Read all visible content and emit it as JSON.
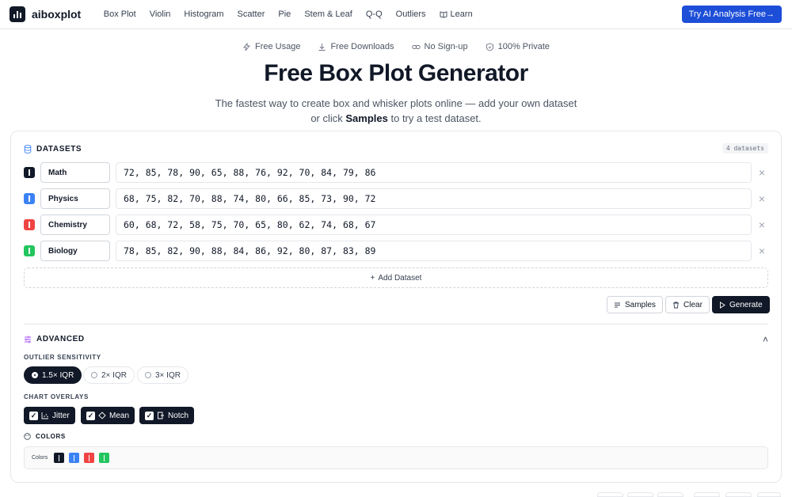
{
  "nav": {
    "logo_text": "aiboxplot",
    "links": [
      "Box Plot",
      "Violin",
      "Histogram",
      "Scatter",
      "Pie",
      "Stem & Leaf",
      "Q-Q",
      "Outliers",
      "Learn"
    ],
    "cta": "Try AI Analysis Free→"
  },
  "badges": [
    "Free Usage",
    "Free Downloads",
    "No Sign-up",
    "100% Private"
  ],
  "hero": {
    "title": "Free Box Plot Generator",
    "subtitle_pre": "The fastest way to create box and whisker plots online — add your own dataset or click ",
    "subtitle_bold": "Samples",
    "subtitle_post": " to try a test dataset."
  },
  "datasets": {
    "heading": "DATASETS",
    "count": "4 datasets",
    "rows": [
      {
        "name": "Math",
        "values": "72, 85, 78, 90, 65, 88, 76, 92, 70, 84, 79, 86",
        "color": "#111827"
      },
      {
        "name": "Physics",
        "values": "68, 75, 82, 70, 88, 74, 80, 66, 85, 73, 90, 72",
        "color": "#3b82f6"
      },
      {
        "name": "Chemistry",
        "values": "60, 68, 72, 58, 75, 70, 65, 80, 62, 74, 68, 67",
        "color": "#ef4444"
      },
      {
        "name": "Biology",
        "values": "78, 85, 82, 90, 88, 84, 86, 92, 80, 87, 83, 89",
        "color": "#22c55e"
      }
    ],
    "add_label": "Add Dataset",
    "samples_label": "Samples",
    "clear_label": "Clear",
    "generate_label": "Generate"
  },
  "advanced": {
    "heading": "ADVANCED",
    "outlier_label": "OUTLIER SENSITIVITY",
    "outlier_options": [
      "1.5× IQR",
      "2× IQR",
      "3× IQR"
    ],
    "outlier_selected": "1.5× IQR",
    "overlays_label": "CHART OVERLAYS",
    "overlays": [
      "Jitter",
      "Mean",
      "Notch"
    ],
    "colors_label": "COLORS",
    "colors_row_label": "Colors",
    "colors": [
      "#111827",
      "#3b82f6",
      "#ef4444",
      "#22c55e"
    ]
  }
}
